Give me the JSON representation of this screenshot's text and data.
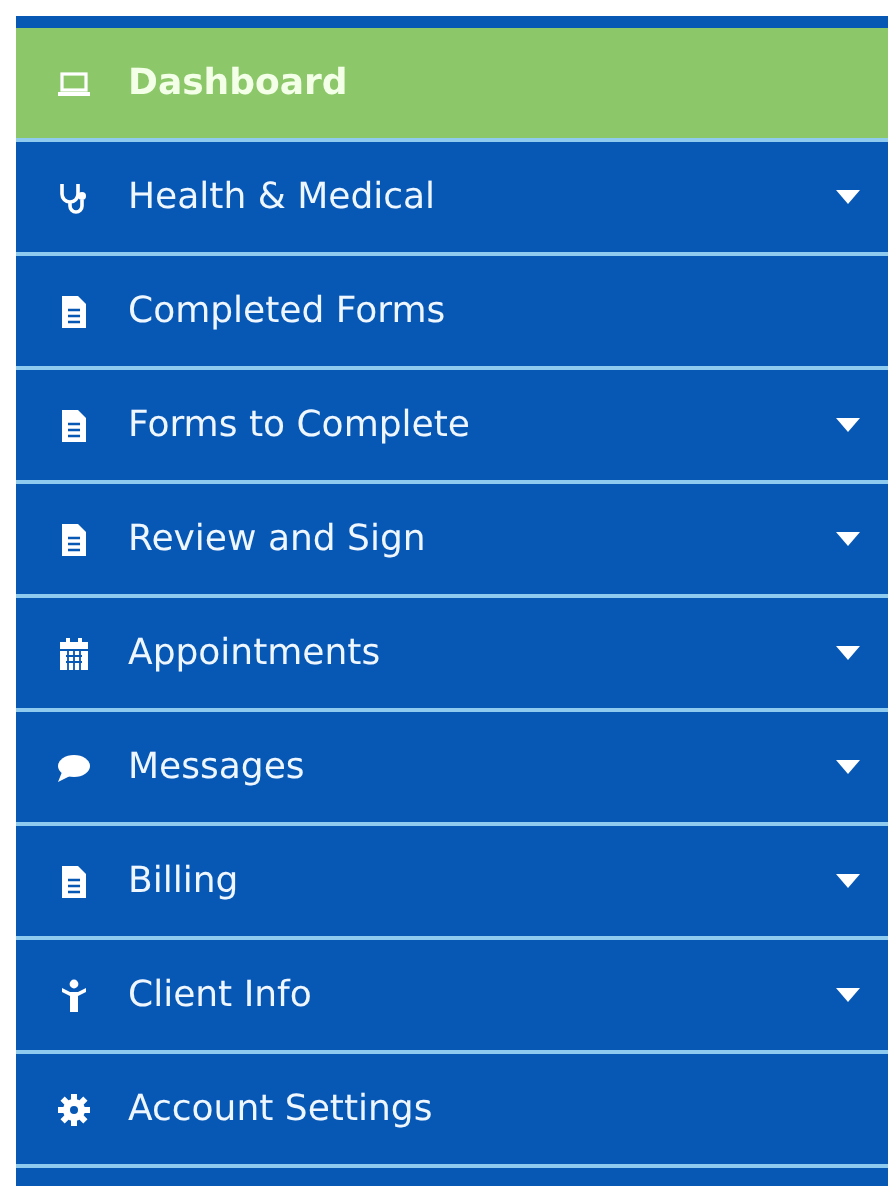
{
  "menu": [
    {
      "kind": "laptop",
      "label": "Dashboard",
      "selected": true,
      "expandable": false
    },
    {
      "kind": "stethoscope",
      "label": "Health & Medical",
      "selected": false,
      "expandable": true
    },
    {
      "kind": "document",
      "label": "Completed Forms",
      "selected": false,
      "expandable": false
    },
    {
      "kind": "document",
      "label": "Forms to Complete",
      "selected": false,
      "expandable": true
    },
    {
      "kind": "document",
      "label": "Review and Sign",
      "selected": false,
      "expandable": true
    },
    {
      "kind": "calendar",
      "label": "Appointments",
      "selected": false,
      "expandable": true
    },
    {
      "kind": "chat",
      "label": "Messages",
      "selected": false,
      "expandable": true
    },
    {
      "kind": "document",
      "label": "Billing",
      "selected": false,
      "expandable": true
    },
    {
      "kind": "person",
      "label": "Client Info",
      "selected": false,
      "expandable": true
    },
    {
      "kind": "gear",
      "label": "Account Settings",
      "selected": false,
      "expandable": false
    }
  ]
}
